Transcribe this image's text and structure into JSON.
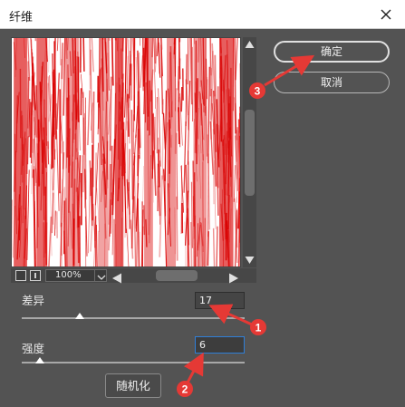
{
  "window": {
    "title": "纤维"
  },
  "preview": {
    "zoom_label": "100%"
  },
  "buttons": {
    "ok_label": "确定",
    "cancel_label": "取消",
    "randomize_label": "随机化"
  },
  "params": {
    "variance": {
      "label": "差异",
      "value": "17",
      "slider_fraction": 0.26
    },
    "strength": {
      "label": "强度",
      "value": "6",
      "slider_fraction": 0.08
    }
  },
  "annotations": {
    "badge_1": "1",
    "badge_2": "2",
    "badge_3": "3"
  },
  "colors": {
    "accent_red": "#e53935",
    "fiber_red": "#d90000",
    "dialog_bg": "#535353",
    "focus_blue": "#2f7fd8"
  },
  "icons": [
    "close-icon",
    "scroll-up-arrow-icon",
    "scroll-down-arrow-icon",
    "scroll-left-arrow-icon",
    "scroll-right-arrow-icon",
    "dropdown-arrow-icon"
  ]
}
